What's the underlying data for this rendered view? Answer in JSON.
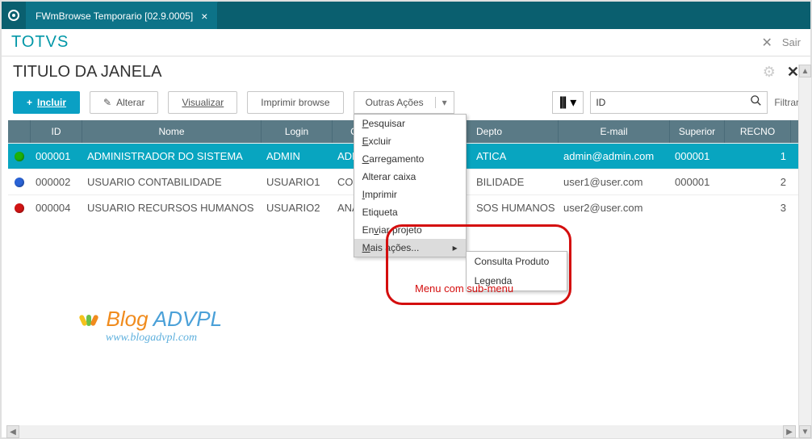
{
  "titlebar": {
    "tab_label": "FWmBrowse Temporario [02.9.0005]"
  },
  "brand": {
    "name": "TOTVS",
    "exit_label": "Sair"
  },
  "window": {
    "title": "TITULO DA JANELA"
  },
  "toolbar": {
    "include": "Incluir",
    "alter": "Alterar",
    "view": "Visualizar",
    "print": "Imprimir browse",
    "other_actions": "Outras Ações",
    "search_field_label": "ID",
    "filter": "Filtrar"
  },
  "dropdown": {
    "items": [
      {
        "label": "Pesquisar",
        "ul_first": true
      },
      {
        "label": "Excluir",
        "ul_first": true
      },
      {
        "label": "Carregamento",
        "ul_first": true
      },
      {
        "label": "Alterar caixa"
      },
      {
        "label": "Imprimir",
        "ul_first": true
      },
      {
        "label": "Etiqueta"
      },
      {
        "label": "Enviar projeto",
        "ul_n": 3
      },
      {
        "label": "Mais ações...",
        "ul_first": true,
        "submenu": true,
        "highlight": true
      }
    ],
    "submenu": [
      "Consulta Produto",
      "Legenda"
    ]
  },
  "columns": [
    "",
    "ID",
    "Nome",
    "Login",
    "Cargo",
    "Depto",
    "E-mail",
    "Superior",
    "RECNO"
  ],
  "rows": [
    {
      "status": "green",
      "id": "000001",
      "nome": "ADMINISTRADOR DO SISTEMA",
      "login": "ADMIN",
      "cargo": "ADMINISTR",
      "depto": "ATICA",
      "email": "admin@admin.com",
      "superior": "000001",
      "recno": "1",
      "selected": true
    },
    {
      "status": "blue",
      "id": "000002",
      "nome": "USUARIO CONTABILIDADE",
      "login": "USUARIO1",
      "cargo": "CONTADO",
      "depto": "BILIDADE",
      "email": "user1@user.com",
      "superior": "000001",
      "recno": "2"
    },
    {
      "status": "red",
      "id": "000004",
      "nome": "USUARIO RECURSOS HUMANOS",
      "login": "USUARIO2",
      "cargo": "ANALISTA",
      "depto": "SOS HUMANOS",
      "email": "user2@user.com",
      "superior": "",
      "recno": "3"
    }
  ],
  "annotation": {
    "text": "Menu com sub-menu"
  },
  "logo": {
    "line1_a": "Blog ",
    "line1_b": "ADVPL",
    "line2": "www.blogadvpl.com"
  }
}
